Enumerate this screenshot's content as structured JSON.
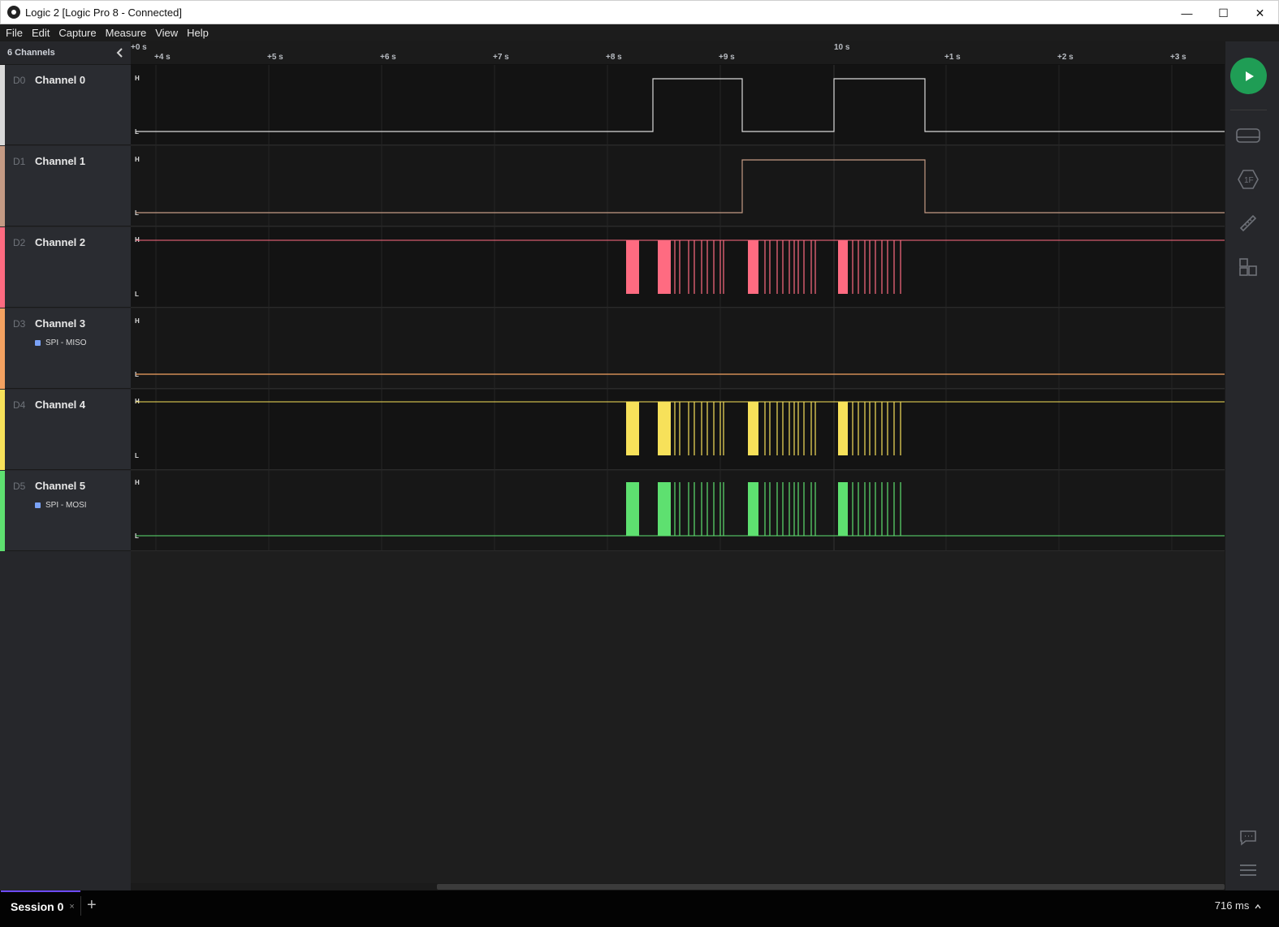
{
  "window": {
    "title": "Logic 2 [Logic Pro 8 - Connected]",
    "min": "—",
    "max": "☐",
    "close": "✕"
  },
  "menu": [
    "File",
    "Edit",
    "Capture",
    "Measure",
    "View",
    "Help"
  ],
  "sidebar": {
    "header": "6 Channels",
    "collapse_icon": "chevron-left-icon"
  },
  "channels": [
    {
      "id": "D0",
      "name": "Channel 0",
      "color": "#d9d9d9",
      "analyzer": ""
    },
    {
      "id": "D1",
      "name": "Channel 1",
      "color": "#c49a84",
      "analyzer": ""
    },
    {
      "id": "D2",
      "name": "Channel 2",
      "color": "#ff6b81",
      "analyzer": ""
    },
    {
      "id": "D3",
      "name": "Channel 3",
      "color": "#f4a261",
      "analyzer": "SPI - MISO"
    },
    {
      "id": "D4",
      "name": "Channel 4",
      "color": "#f7e15a",
      "analyzer": ""
    },
    {
      "id": "D5",
      "name": "Channel 5",
      "color": "#5ee070",
      "analyzer": "SPI - MOSI"
    }
  ],
  "ruler": {
    "origin": "+0 s",
    "ticks": [
      "+4 s",
      "+5 s",
      "+6 s",
      "+7 s",
      "+8 s",
      "+9 s",
      "10 s",
      "+1 s",
      "+2 s",
      "+3 s"
    ]
  },
  "levels": {
    "high": "H",
    "low": "L"
  },
  "session": {
    "tab": "Session 0",
    "close": "×",
    "add": "+"
  },
  "zoom": {
    "value": "716 ms",
    "caret": "^"
  }
}
